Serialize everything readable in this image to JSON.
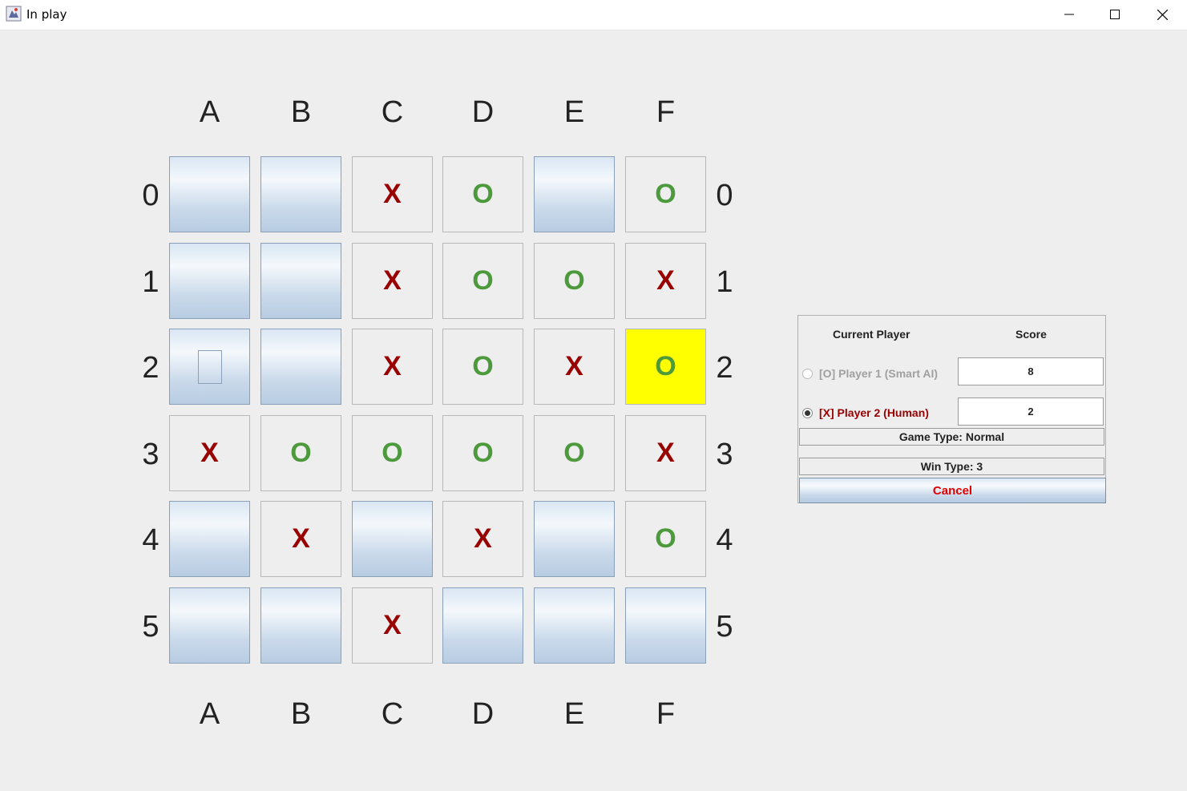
{
  "window": {
    "title": "In play",
    "icon": "java-app-icon",
    "controls": [
      "minimize-icon",
      "maximize-icon",
      "close-icon"
    ]
  },
  "board": {
    "columns": [
      "A",
      "B",
      "C",
      "D",
      "E",
      "F"
    ],
    "rows": [
      "0",
      "1",
      "2",
      "3",
      "4",
      "5"
    ],
    "cells": [
      [
        "",
        "",
        "X",
        "O",
        "",
        "O"
      ],
      [
        "",
        "",
        "X",
        "O",
        "O",
        "X"
      ],
      [
        "",
        "",
        "X",
        "O",
        "X",
        "O"
      ],
      [
        "X",
        "O",
        "O",
        "O",
        "O",
        "X"
      ],
      [
        "",
        "X",
        "",
        "X",
        "",
        "O"
      ],
      [
        "",
        "",
        "X",
        "",
        "",
        ""
      ]
    ],
    "highlighted_cell": "F2",
    "focused_cell": "A2",
    "colors": {
      "x": "#990000",
      "o": "#4c9a3c",
      "highlight": "#ffff00"
    }
  },
  "panel": {
    "header_player": "Current Player",
    "header_score": "Score",
    "players": [
      {
        "label": "[O] Player 1 (Smart AI)",
        "score": "8",
        "selected": false
      },
      {
        "label": "[X] Player 2 (Human)",
        "score": "2",
        "selected": true
      }
    ],
    "game_type": "Game Type: Normal",
    "win_type": "Win Type: 3",
    "cancel_label": "Cancel",
    "cancel_color": "#e00000"
  }
}
